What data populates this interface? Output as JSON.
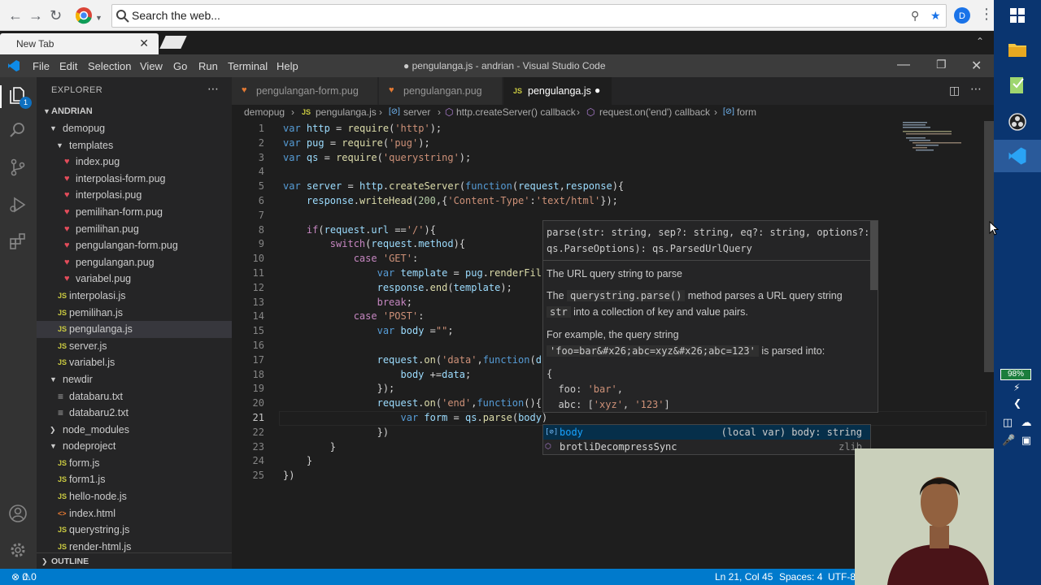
{
  "browser": {
    "address_placeholder": "Search the web...",
    "tab_label": "New Tab"
  },
  "vscode": {
    "menu": [
      "File",
      "Edit",
      "Selection",
      "View",
      "Go",
      "Run",
      "Terminal",
      "Help"
    ],
    "window_title": "● pengulanga.js - andrian - Visual Studio Code",
    "explorer_title": "EXPLORER",
    "root_folder": "ANDRIAN",
    "tree": [
      {
        "name": "demopug",
        "type": "folder",
        "depth": 1
      },
      {
        "name": "templates",
        "type": "folder",
        "depth": 2
      },
      {
        "name": "index.pug",
        "type": "pug",
        "depth": 3
      },
      {
        "name": "interpolasi-form.pug",
        "type": "pug",
        "depth": 3
      },
      {
        "name": "interpolasi.pug",
        "type": "pug",
        "depth": 3
      },
      {
        "name": "pemilihan-form.pug",
        "type": "pug",
        "depth": 3
      },
      {
        "name": "pemilihan.pug",
        "type": "pug",
        "depth": 3
      },
      {
        "name": "pengulangan-form.pug",
        "type": "pug",
        "depth": 3
      },
      {
        "name": "pengulangan.pug",
        "type": "pug",
        "depth": 3
      },
      {
        "name": "variabel.pug",
        "type": "pug",
        "depth": 3
      },
      {
        "name": "interpolasi.js",
        "type": "js",
        "depth": 2
      },
      {
        "name": "pemilihan.js",
        "type": "js",
        "depth": 2
      },
      {
        "name": "pengulanga.js",
        "type": "js",
        "depth": 2,
        "selected": true
      },
      {
        "name": "server.js",
        "type": "js",
        "depth": 2
      },
      {
        "name": "variabel.js",
        "type": "js",
        "depth": 2
      },
      {
        "name": "newdir",
        "type": "folder",
        "depth": 1
      },
      {
        "name": "databaru.txt",
        "type": "txt",
        "depth": 2
      },
      {
        "name": "databaru2.txt",
        "type": "txt",
        "depth": 2
      },
      {
        "name": "node_modules",
        "type": "folder-closed",
        "depth": 1
      },
      {
        "name": "nodeproject",
        "type": "folder",
        "depth": 1
      },
      {
        "name": "form.js",
        "type": "js",
        "depth": 2
      },
      {
        "name": "form1.js",
        "type": "js",
        "depth": 2
      },
      {
        "name": "hello-node.js",
        "type": "js",
        "depth": 2
      },
      {
        "name": "index.html",
        "type": "html",
        "depth": 2
      },
      {
        "name": "querystring.js",
        "type": "js",
        "depth": 2
      },
      {
        "name": "render-html.js",
        "type": "js",
        "depth": 2
      }
    ],
    "outline_label": "OUTLINE",
    "tabs": [
      {
        "label": "pengulangan-form.pug",
        "type": "pug"
      },
      {
        "label": "pengulangan.pug",
        "type": "pug"
      },
      {
        "label": "pengulanga.js",
        "type": "js",
        "active": true,
        "dirty": true
      }
    ],
    "breadcrumb": [
      "demopug",
      "pengulanga.js",
      "server",
      "http.createServer() callback",
      "request.on('end') callback",
      "form"
    ],
    "code_lines": [
      "var http = require('http');",
      "var pug = require('pug');",
      "var qs = require('querystring');",
      "",
      "var server = http.createServer(function(request,response){",
      "    response.writeHead(200,{'Content-Type':'text/html'});",
      "",
      "    if(request.url =='/'){",
      "        switch(request.method){",
      "            case 'GET':",
      "                var template = pug.renderFil",
      "                response.end(template);",
      "                break;",
      "            case 'POST':",
      "                var body =\"\";",
      "",
      "                request.on('data',function(d",
      "                    body +=data;",
      "                });",
      "                request.on('end',function(){",
      "                    var form = qs.parse(body)",
      "                })",
      "        }",
      "    }",
      "})"
    ],
    "hover": {
      "signature_1": "parse(str: string, sep?: string, eq?: string, options?:",
      "signature_2": "qs.ParseOptions): qs.ParsedUrlQuery",
      "param_doc": "The URL query string to parse",
      "desc_pre": "The",
      "desc_code": "querystring.parse()",
      "desc_post": "method parses a URL query string",
      "desc2_code": "str",
      "desc2_post": "into a collection of key and value pairs.",
      "example_intro": "For example, the query string",
      "example_code": "'foo=bar&#x26;abc=xyz&#x26;abc=123'",
      "example_post": "is parsed into:",
      "code_1": "{",
      "code_2": "  foo: 'bar',",
      "code_3": "  abc: ['xyz', '123']"
    },
    "suggestions": [
      {
        "label": "body",
        "detail": "(local var) body: string",
        "selected": true
      },
      {
        "label": "brotliDecompressSync",
        "detail": "zlib"
      }
    ],
    "status": {
      "errors": "0",
      "warnings": "0",
      "position": "Ln 21, Col 45",
      "spaces": "Spaces: 4",
      "encoding": "UTF-8"
    }
  },
  "taskbar": {
    "battery": "98%"
  },
  "colors": {
    "accent": "#007acc",
    "activity_bar": "#333333",
    "sidebar": "#252526",
    "editor": "#1e1e1e"
  }
}
